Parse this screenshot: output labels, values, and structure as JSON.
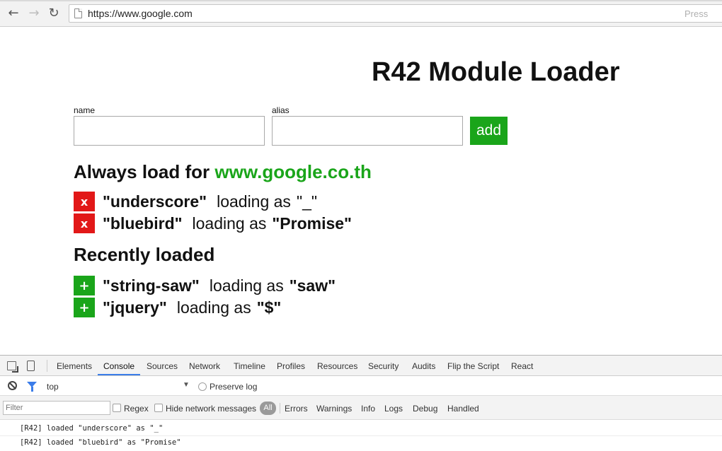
{
  "browser": {
    "url": "https://www.google.com",
    "omnibox_hint": "Press"
  },
  "page": {
    "title": "R42 Module Loader",
    "form": {
      "name_label": "name",
      "alias_label": "alias",
      "name_value": "",
      "alias_value": "",
      "add_label": "add"
    },
    "always": {
      "heading_prefix": "Always load for",
      "site": "www.google.co.th",
      "items": [
        {
          "button": "x",
          "module": "\"underscore\"",
          "as_text": "loading as",
          "alias": "\"_\"",
          "alias_bold": false
        },
        {
          "button": "x",
          "module": "\"bluebird\"",
          "as_text": "loading as",
          "alias": "\"Promise\"",
          "alias_bold": true
        }
      ]
    },
    "recent": {
      "heading": "Recently loaded",
      "items": [
        {
          "button": "+",
          "module": "\"string-saw\"",
          "as_text": "loading as",
          "alias": "\"saw\""
        },
        {
          "button": "+",
          "module": "\"jquery\"",
          "as_text": "loading as",
          "alias": "\"$\""
        }
      ]
    }
  },
  "devtools": {
    "tabs": [
      "Elements",
      "Console",
      "Sources",
      "Network",
      "Timeline",
      "Profiles",
      "Resources",
      "Security",
      "Audits",
      "Flip the Script",
      "React"
    ],
    "active_tab": "Console",
    "context": "top",
    "preserve_log": "Preserve log",
    "filter_placeholder": "Filter",
    "regex": "Regex",
    "hide_network": "Hide network messages",
    "levels": [
      "All",
      "Errors",
      "Warnings",
      "Info",
      "Logs",
      "Debug",
      "Handled"
    ],
    "logs": [
      "[R42] loaded \"underscore\" as \"_\"",
      "[R42] loaded \"bluebird\" as \"Promise\""
    ]
  },
  "colors": {
    "green": "#1aa51a",
    "red": "#e21818",
    "devtools_accent": "#3b7de9"
  }
}
